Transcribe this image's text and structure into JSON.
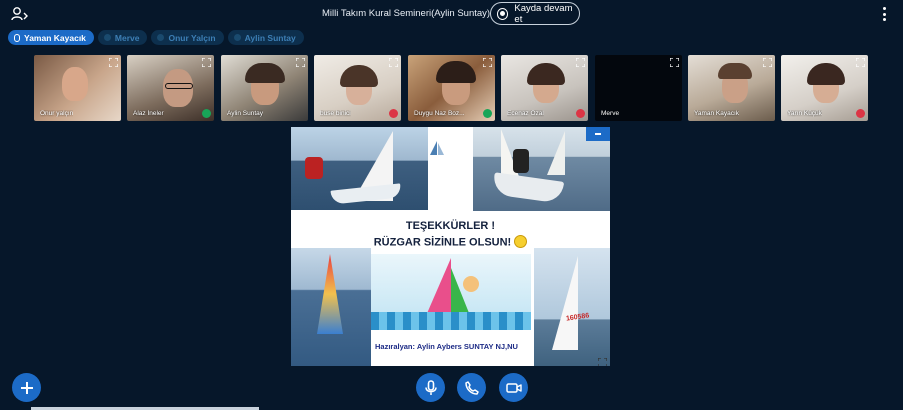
{
  "header": {
    "users_icon": "users-icon",
    "title": "Milli Takım Kural Semineri(Aylin Suntay)",
    "recording_label": "Kayda devam et",
    "options_icon": "kebab-menu-icon"
  },
  "talkers": [
    {
      "name": "Yaman Kayacık",
      "state": "speaking"
    },
    {
      "name": "Merve",
      "state": "muted"
    },
    {
      "name": "Onur Yalçın",
      "state": "muted"
    },
    {
      "name": "Aylin Suntay",
      "state": "muted"
    }
  ],
  "participants": [
    {
      "name": "Onur yalçın",
      "status": "none"
    },
    {
      "name": "Alaz İneler",
      "status": "mic"
    },
    {
      "name": "Aylin Suntay",
      "status": "none"
    },
    {
      "name": "buse binici",
      "status": "off"
    },
    {
      "name": "Duygu Naz Boz...",
      "status": "mic"
    },
    {
      "name": "Ecenaz Özal",
      "status": "off"
    },
    {
      "name": "Merve",
      "status": "none"
    },
    {
      "name": "Yaman Kayacık",
      "status": "none"
    },
    {
      "name": "Yarın Küçük",
      "status": "off"
    }
  ],
  "presentation": {
    "line1": "TEŞEKKÜRLER !",
    "line2": "RÜZGAR SİZİNLE OLSUN!",
    "footer": "Hazıralyan: Aylin Aybers SUNTAY NJ,NU",
    "sail_number": "160586"
  },
  "controls": {
    "actions_icon": "plus-icon",
    "mic_icon": "microphone-icon",
    "audio_icon": "phone-icon",
    "camera_icon": "video-camera-icon"
  },
  "colors": {
    "background": "#06172a",
    "accent": "#1c6bc7",
    "muted_chip": "#0d2f4d"
  }
}
